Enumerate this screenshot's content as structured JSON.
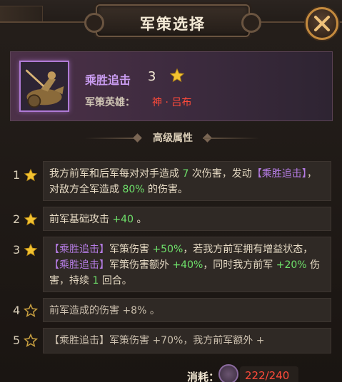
{
  "dialog": {
    "title": "军策选择"
  },
  "strategy": {
    "name": "乘胜追击",
    "level": "3",
    "hero_label": "军策英雄：",
    "hero_name": "神 · 吕布"
  },
  "section_title": "高级属性",
  "attributes": [
    {
      "num": "1",
      "star": "filled",
      "parts": [
        "我方前军和后军每对对手造成",
        " 7 ",
        "次伤害，发动",
        "【乘胜追击】",
        "，对敌方全军造成",
        " 80% ",
        "的伤害。"
      ]
    },
    {
      "num": "2",
      "star": "filled",
      "parts": [
        "前军基础攻击",
        " +40 ",
        "。"
      ]
    },
    {
      "num": "3",
      "star": "filled",
      "parts": [
        "【乘胜追击】",
        "军策伤害",
        " +50%",
        "，若我方前军拥有增益状态，",
        "【乘胜追击】",
        "军策伤害额外",
        " +40%",
        "，同时我方前军",
        " +20% ",
        "伤害，持续",
        " 1 ",
        "回合。"
      ]
    },
    {
      "num": "4",
      "star": "outline",
      "parts": [
        "前军造成的伤害",
        " +8% ",
        "。"
      ]
    },
    {
      "num": "5",
      "star": "outline",
      "parts": [
        "【乘胜追击】",
        "军策伤害",
        " +70%",
        "，我方前军额外",
        " +"
      ]
    }
  ],
  "footer": {
    "cost_label": "消耗：",
    "cost_value": "222/240"
  },
  "colors": {
    "keyword": "#b57ce4",
    "number": "#6ee06a",
    "hero_name": "#ff4a3a",
    "star": "#f2c230"
  },
  "icons": [
    "close-icon",
    "star-icon",
    "star-outline-icon",
    "hero-portrait-icon",
    "cost-token-icon"
  ]
}
